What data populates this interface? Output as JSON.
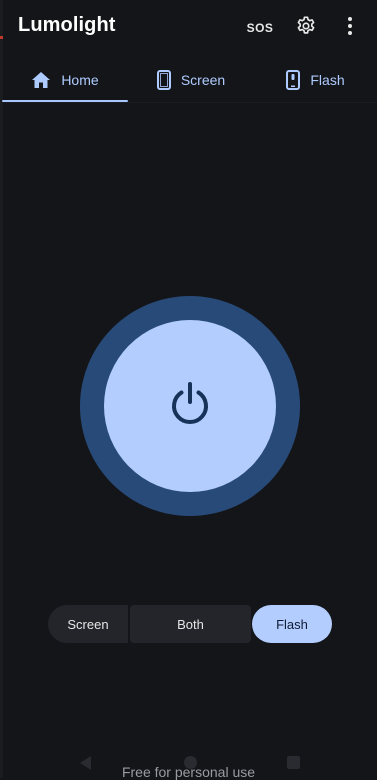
{
  "app": {
    "title": "Lumolight"
  },
  "toolbar": {
    "sos_label": "SOS",
    "settings_icon": "gear-icon",
    "more_icon": "more-vert-icon"
  },
  "tabs": [
    {
      "label": "Home",
      "icon": "home-icon",
      "selected": true
    },
    {
      "label": "Screen",
      "icon": "phone-screen-icon",
      "selected": false
    },
    {
      "label": "Flash",
      "icon": "phone-flash-icon",
      "selected": false
    }
  ],
  "power": {
    "icon": "power-icon"
  },
  "mode_selector": {
    "options": [
      "Screen",
      "Both",
      "Flash"
    ],
    "selected": "Flash"
  },
  "footer": {
    "text": "Free for personal use"
  },
  "colors": {
    "background": "#141519",
    "accent": "#b3cdff",
    "accent_dark": "#284a79",
    "surface": "#23252b"
  }
}
